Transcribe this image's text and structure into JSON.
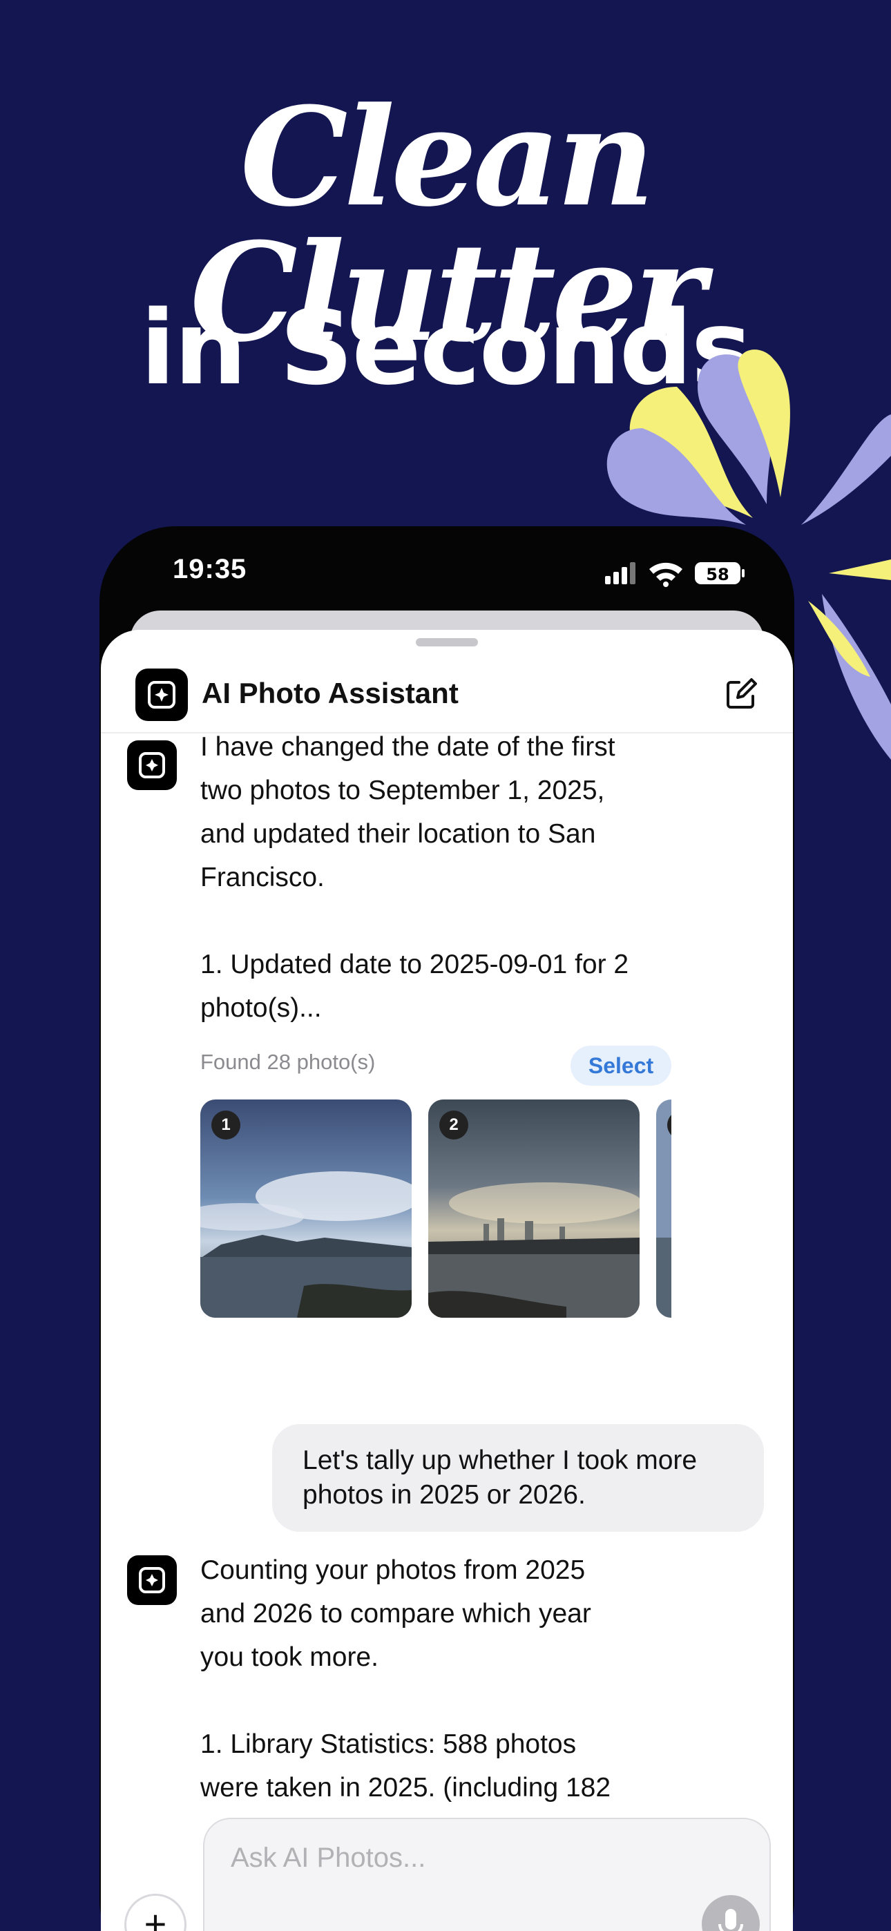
{
  "headline": {
    "line1": "Clean Clutter",
    "line2": "in Seconds"
  },
  "status_bar": {
    "time": "19:35",
    "battery": "58"
  },
  "header": {
    "title": "AI Photo Assistant"
  },
  "messages": {
    "bot1": "I have changed the date of the first\ntwo photos to September 1, 2025,\nand updated their location to San\nFrancisco.\n\n1. Updated date to 2025-09-01 for 2\nphoto(s)...",
    "found_label": "Found 28 photo(s)",
    "select_label": "Select",
    "thumbs": [
      "1",
      "2"
    ],
    "user1": "Let's tally up whether I took more photos in 2025 or 2026.",
    "bot2": "Counting your photos from 2025\nand 2026 to compare which year\nyou took more.\n\n1. Library Statistics: 588 photos\nwere taken in 2025. (including 182"
  },
  "composer": {
    "placeholder": "Ask AI Photos...",
    "plus": "+"
  },
  "colors": {
    "background": "#131651",
    "accent": "#3478d8",
    "burst_lavender": "#a3a3e3",
    "burst_yellow": "#f5f07a"
  }
}
